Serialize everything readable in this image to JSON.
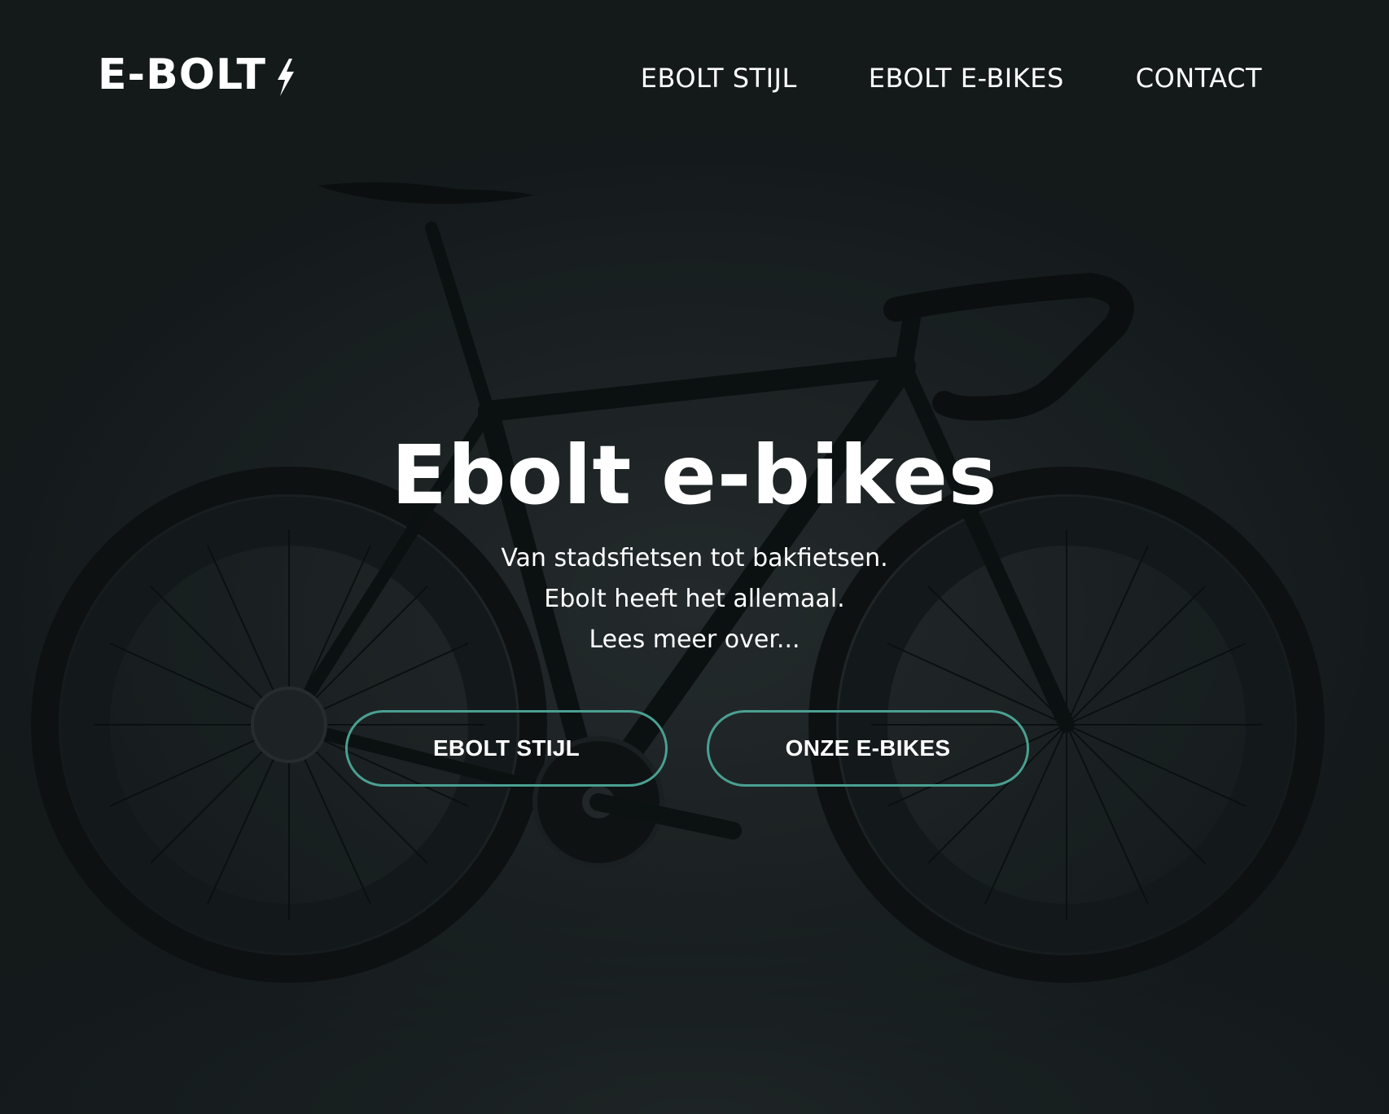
{
  "brand": {
    "logo_text": "E-BOLT",
    "logo_icon": "lightning-bolt-icon"
  },
  "nav": {
    "items": [
      {
        "label": "EBOLT STIJL"
      },
      {
        "label": "EBOLT E-BIKES"
      },
      {
        "label": "CONTACT"
      }
    ]
  },
  "hero": {
    "title": "Ebolt e-bikes",
    "subtitle_lines": [
      "Van stadsfietsen tot bakfietsen.",
      "Ebolt heeft het allemaal.",
      "Lees meer over..."
    ],
    "buttons": [
      {
        "label": "EBOLT STIJL"
      },
      {
        "label": "ONZE E-BIKES"
      }
    ]
  },
  "colors": {
    "accent": "#4aa092",
    "background": "#1c2122",
    "text": "#ffffff"
  }
}
